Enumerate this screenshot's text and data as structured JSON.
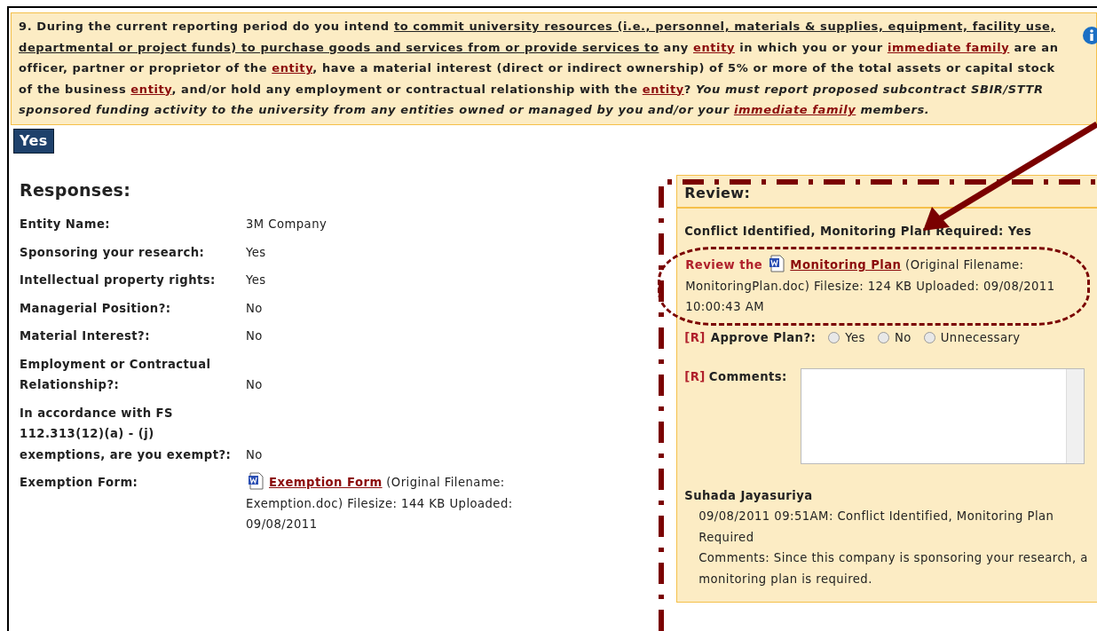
{
  "question": {
    "segments": [
      {
        "kind": "plain",
        "text": "9. During the current reporting period do you intend "
      },
      {
        "kind": "underline",
        "text": "to commit university resources (i.e., personnel, materials & supplies, equipment, facility use, departmental or project funds) to purchase goods and services from or provide services to"
      },
      {
        "kind": "plain",
        "text": " any "
      },
      {
        "kind": "link",
        "text": "entity"
      },
      {
        "kind": "plain",
        "text": " in which you or your "
      },
      {
        "kind": "link",
        "text": "immediate family"
      },
      {
        "kind": "plain",
        "text": " are an officer, partner or proprietor of the "
      },
      {
        "kind": "link",
        "text": "entity"
      },
      {
        "kind": "plain",
        "text": ", have a material interest (direct or indirect ownership) of 5% or more of the total assets or capital stock of the business "
      },
      {
        "kind": "link",
        "text": "entity"
      },
      {
        "kind": "plain",
        "text": ", and/or hold any employment or contractual relationship with the "
      },
      {
        "kind": "link",
        "text": "entity"
      },
      {
        "kind": "plain",
        "text": "? "
      },
      {
        "kind": "italic",
        "text": "You must report proposed subcontract SBIR/STTR sponsored funding activity to the university from any entities owned or managed by you and/or your "
      },
      {
        "kind": "italic-link",
        "text": "immediate family"
      },
      {
        "kind": "italic",
        "text": " members."
      }
    ]
  },
  "answer": "Yes",
  "responses": {
    "title": "Responses:",
    "rows": [
      {
        "kind": "text",
        "label": "Entity Name:",
        "value": "3M Company"
      },
      {
        "kind": "text",
        "label": "Sponsoring your research:",
        "value": "Yes"
      },
      {
        "kind": "text",
        "label": "Intellectual property rights:",
        "value": "Yes"
      },
      {
        "kind": "text",
        "label": "Managerial Position?:",
        "value": "No"
      },
      {
        "kind": "text",
        "label": "Material Interest?:",
        "value": "No"
      },
      {
        "kind": "text",
        "label": "Employment or Contractual Relationship?:",
        "value": "No"
      },
      {
        "kind": "text",
        "label": "In accordance with FS 112.313(12)(a) - (j) exemptions, are you exempt?:",
        "value": "No"
      },
      {
        "kind": "file",
        "label": "Exemption Form:",
        "link": "Exemption Form",
        "details": "(Original Filename: Exemption.doc)  Filesize: 144 KB  Uploaded: 09/08/2011"
      }
    ]
  },
  "review": {
    "title": "Review:",
    "conflict": "Conflict Identified, Monitoring Plan Required: Yes",
    "file": {
      "prefix": "Review the",
      "link": "Monitoring Plan",
      "details": "(Original Filename: MonitoringPlan.doc) Filesize: 124 KB Uploaded: 09/08/2011 10:00:43 AM"
    },
    "approve": {
      "required": "[R]",
      "label": "Approve Plan?:",
      "options": [
        {
          "label": "Yes",
          "selected": false
        },
        {
          "label": "No",
          "selected": false
        },
        {
          "label": "Unnecessary",
          "selected": false
        }
      ]
    },
    "comments": {
      "required": "[R]",
      "label": "Comments:"
    },
    "history": {
      "name": "Suhada Jayasuriya",
      "entry": "09/08/2011 09:51AM: Conflict Identified, Monitoring Plan Required",
      "comments": "Comments: Since this company is sponsoring your research, a monitoring plan is required."
    }
  }
}
